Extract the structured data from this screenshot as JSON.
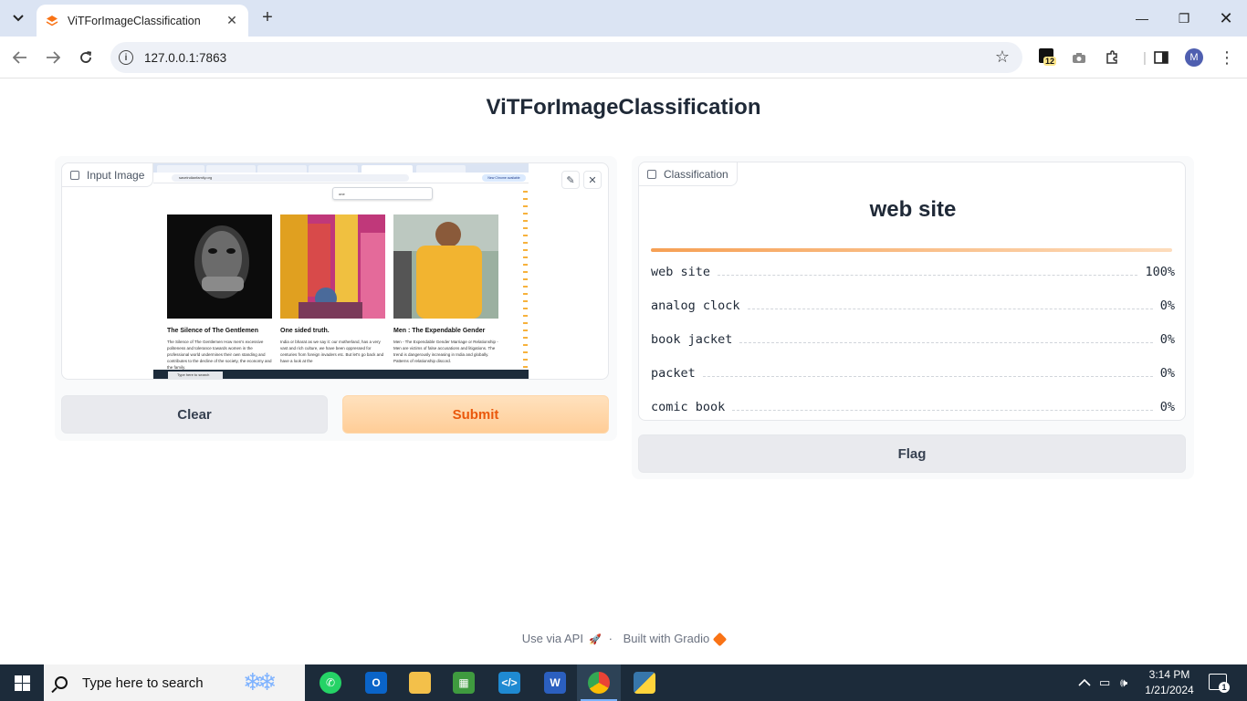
{
  "browser": {
    "tab_title": "ViTForImageClassification",
    "url": "127.0.0.1:7863",
    "extension_badge": "12",
    "profile_initial": "M"
  },
  "app": {
    "title": "ViTForImageClassification",
    "input_label": "Input Image",
    "clear_label": "Clear",
    "submit_label": "Submit",
    "output_label": "Classification",
    "top_label": "web site",
    "top_confidence": 1.0,
    "predictions": [
      {
        "label": "web site",
        "confidence": "100%"
      },
      {
        "label": "analog clock",
        "confidence": "0%"
      },
      {
        "label": "book jacket",
        "confidence": "0%"
      },
      {
        "label": "packet",
        "confidence": "0%"
      },
      {
        "label": "comic book",
        "confidence": "0%"
      }
    ],
    "flag_label": "Flag"
  },
  "input_preview": {
    "cards": [
      {
        "title": "The Silence of The Gentlemen",
        "text": "The Silence of The Gentlemen How men's excessive politeness and tolerance towards women in the professional world undermines their own standing and contributes to the decline of the society, the economy and the family."
      },
      {
        "title": "One sided truth.",
        "text": "India or bharat as we say it: our motherland, has a very vast and rich culture, we have been oppressed for centuries from foreign invaders etc. But let's go back and have a look at the"
      },
      {
        "title": "Men : The Expendable Gender",
        "text": "Men - The Expendable Gender Marriage or Relationship - Men are victims of false accusations and litigations. The trend is dangerously increasing in India and globally. Patterns of relationship discord."
      }
    ],
    "find_text": "one",
    "site_url": "saveindianfamily.org",
    "update_pill": "New Chrome available",
    "taskbar_search": "Type here to search"
  },
  "footer": {
    "api_text": "Use via API",
    "separator": "·",
    "built_text": "Built with Gradio"
  },
  "taskbar": {
    "search_placeholder": "Type here to search",
    "time": "3:14 PM",
    "date": "1/21/2024",
    "notification_count": "1"
  },
  "colors": {
    "accent_orange": "#f97316",
    "submit_bg": "#ffcd97",
    "chrome_tabstrip": "#dbe4f3",
    "taskbar_bg": "#1c2b3a"
  }
}
